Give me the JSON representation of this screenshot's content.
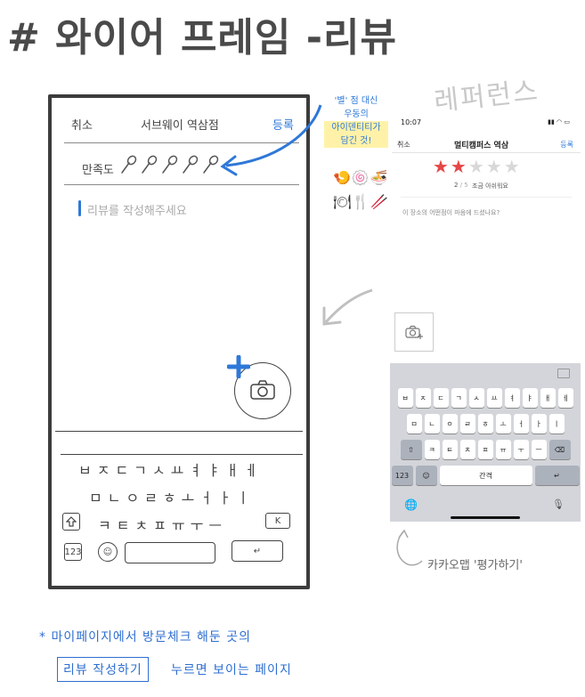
{
  "title": "# 와이어 프레임 -리뷰",
  "reference_label": "레퍼런스",
  "wireframe": {
    "cancel": "취소",
    "store": "서브웨이 역삼점",
    "submit": "등록",
    "satisfaction_label": "만족도",
    "rating_icons": [
      "spoon-icon",
      "spoon-icon",
      "spoon-icon",
      "spoon-icon",
      "spoon-icon"
    ],
    "review_placeholder": "리뷰를 작성해주세요",
    "keyboard": {
      "row1": "ㅂㅈㄷㄱㅅㅛㅕㅑㅐㅔ",
      "row2": "ㅁㄴㅇㄹㅎㅗㅓㅏㅣ",
      "row3": "ㅋㅌㅊㅍㅠㅜㅡ",
      "num_key": "123",
      "backspace_key": "K",
      "enter_key": "↵",
      "emoji_key": "☺"
    }
  },
  "annotation": {
    "lines": [
      "'별' 점 대신",
      "우동의",
      "아이덴티티가",
      "담긴 것!"
    ],
    "foods": "🍤🍥🍜",
    "utensils": "🍽🍴🥢"
  },
  "reference": {
    "time": "10:07",
    "status": "▮▮ ◠ ▭",
    "cancel": "취소",
    "store": "멀티캠퍼스 역삼",
    "submit": "등록",
    "stars_on": "★★",
    "stars_off": "★★★",
    "score_value": "2",
    "score_total": "/ 5",
    "score_hint": "조금 아쉬워요",
    "question": "이 장소의 어떤점이 마음에 드셨나요?",
    "keyboard": {
      "row1": [
        "ㅂ",
        "ㅈ",
        "ㄷ",
        "ㄱ",
        "ㅅ",
        "ㅛ",
        "ㅕ",
        "ㅑ",
        "ㅐ",
        "ㅔ"
      ],
      "row2": [
        "ㅁ",
        "ㄴ",
        "ㅇ",
        "ㄹ",
        "ㅎ",
        "ㅗ",
        "ㅓ",
        "ㅏ",
        "ㅣ"
      ],
      "row3": [
        "ㅋ",
        "ㅌ",
        "ㅊ",
        "ㅍ",
        "ㅠ",
        "ㅜ",
        "ㅡ"
      ],
      "shift": "⇧",
      "backspace": "⌫",
      "num": "123",
      "emoji": "☺",
      "space": "간격",
      "enter": "↵",
      "globe": "🌐",
      "mic": "🎙"
    }
  },
  "kakao_label": "카카오맵 '평가하기'",
  "note": {
    "line1": "* 마이페이지에서 방문체크 해둔 곳의",
    "boxed": "리뷰 작성하기",
    "line2": "누르면 보이는 페이지"
  }
}
